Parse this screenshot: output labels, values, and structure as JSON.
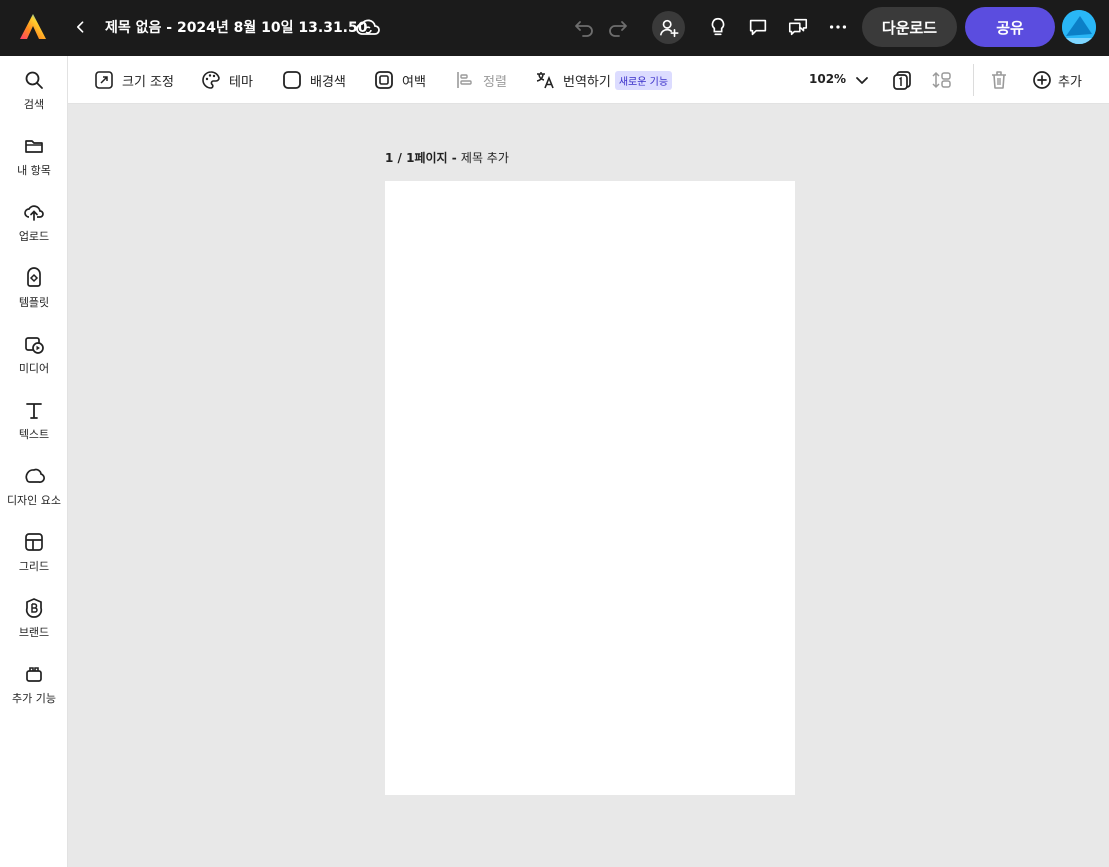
{
  "header": {
    "document_title": "제목 없음 - 2024년 8월 10일 13.31.50",
    "download_label": "다운로드",
    "share_label": "공유",
    "accent_color": "#5b4ddf"
  },
  "sidebar": {
    "items": [
      {
        "label": "검색",
        "icon": "search-icon"
      },
      {
        "label": "내 항목",
        "icon": "folder-icon"
      },
      {
        "label": "업로드",
        "icon": "cloud-upload-icon"
      },
      {
        "label": "템플릿",
        "icon": "template-icon"
      },
      {
        "label": "미디어",
        "icon": "media-icon"
      },
      {
        "label": "텍스트",
        "icon": "text-icon"
      },
      {
        "label": "디자인 요소",
        "icon": "shapes-icon"
      },
      {
        "label": "그리드",
        "icon": "grid-icon"
      },
      {
        "label": "브랜드",
        "icon": "brand-icon"
      },
      {
        "label": "추가 기능",
        "icon": "addons-icon"
      }
    ]
  },
  "toolbar": {
    "resize_label": "크기 조정",
    "theme_label": "테마",
    "background_label": "배경색",
    "margin_label": "여백",
    "align_label": "정렬",
    "translate_label": "번역하기",
    "new_feature_badge": "새로운 기능",
    "zoom_level": "102%",
    "add_label": "추가"
  },
  "canvas": {
    "page_indicator": "1 / 1페이지",
    "page_title_placeholder": "제목 추가",
    "separator": " - "
  }
}
